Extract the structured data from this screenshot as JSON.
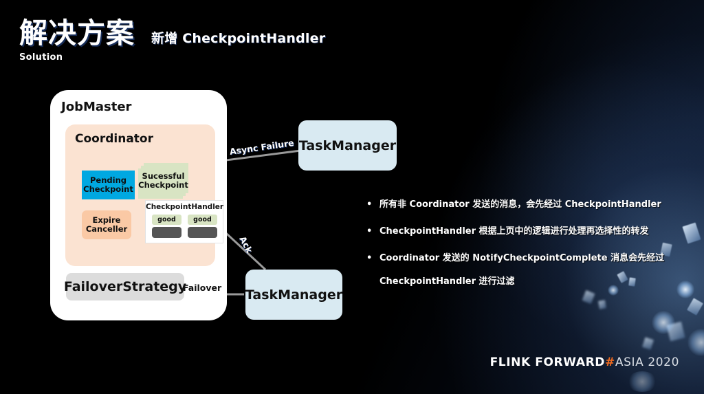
{
  "header": {
    "title_cn": "解决方案",
    "title_en": "Solution",
    "subtitle": "新增 CheckpointHandler"
  },
  "diagram": {
    "jobmaster_label": "JobMaster",
    "coordinator_label": "Coordinator",
    "pending_checkpoint": {
      "line1": "Pending",
      "line2": "Checkpoint",
      "color": "#00a8e1"
    },
    "successful_checkpoint": {
      "line1": "Sucessful",
      "line2": "Checkpoint",
      "color": "#d8e4c3"
    },
    "expire_canceller": {
      "line1": "Expire",
      "line2": "Canceller",
      "color": "#fac9a5"
    },
    "checkpoint_handler": {
      "title": "CheckpointHandler",
      "slots_good": [
        "good",
        "good"
      ],
      "slots_dark": [
        "",
        ""
      ],
      "good_color": "#d8e4c3",
      "dark_color": "#555555"
    },
    "failover_strategy_label": "FailoverStrategy",
    "taskmanager_top_label": "TaskManager",
    "taskmanager_bottom_label": "TaskManager",
    "arrow_labels": {
      "async_failure": "Async Failure",
      "ack": "Ack",
      "failover": "Failover"
    },
    "colors": {
      "panel": "#ffffff",
      "coordinator": "#fbe3d2",
      "taskmanager": "#d9eaf2",
      "failover_strategy": "#dcdcdc",
      "arrow": "#9a9a9a"
    }
  },
  "bullets": [
    {
      "text": "所有非 Coordinator 发送的消息，会先经过 CheckpointHandler",
      "cont": ""
    },
    {
      "text": "CheckpointHandler 根据上页中的逻辑进行处理再选择性的转发",
      "cont": ""
    },
    {
      "text": "Coordinator 发送的 NotifyCheckpointComplete 消息会先经过",
      "cont": "CheckpointHandler 进行过滤"
    }
  ],
  "footer": {
    "flink_forward": "FLINK FORWARD",
    "hash": "#",
    "asia": "ASIA 2020",
    "accent": "#ef6a1f"
  }
}
